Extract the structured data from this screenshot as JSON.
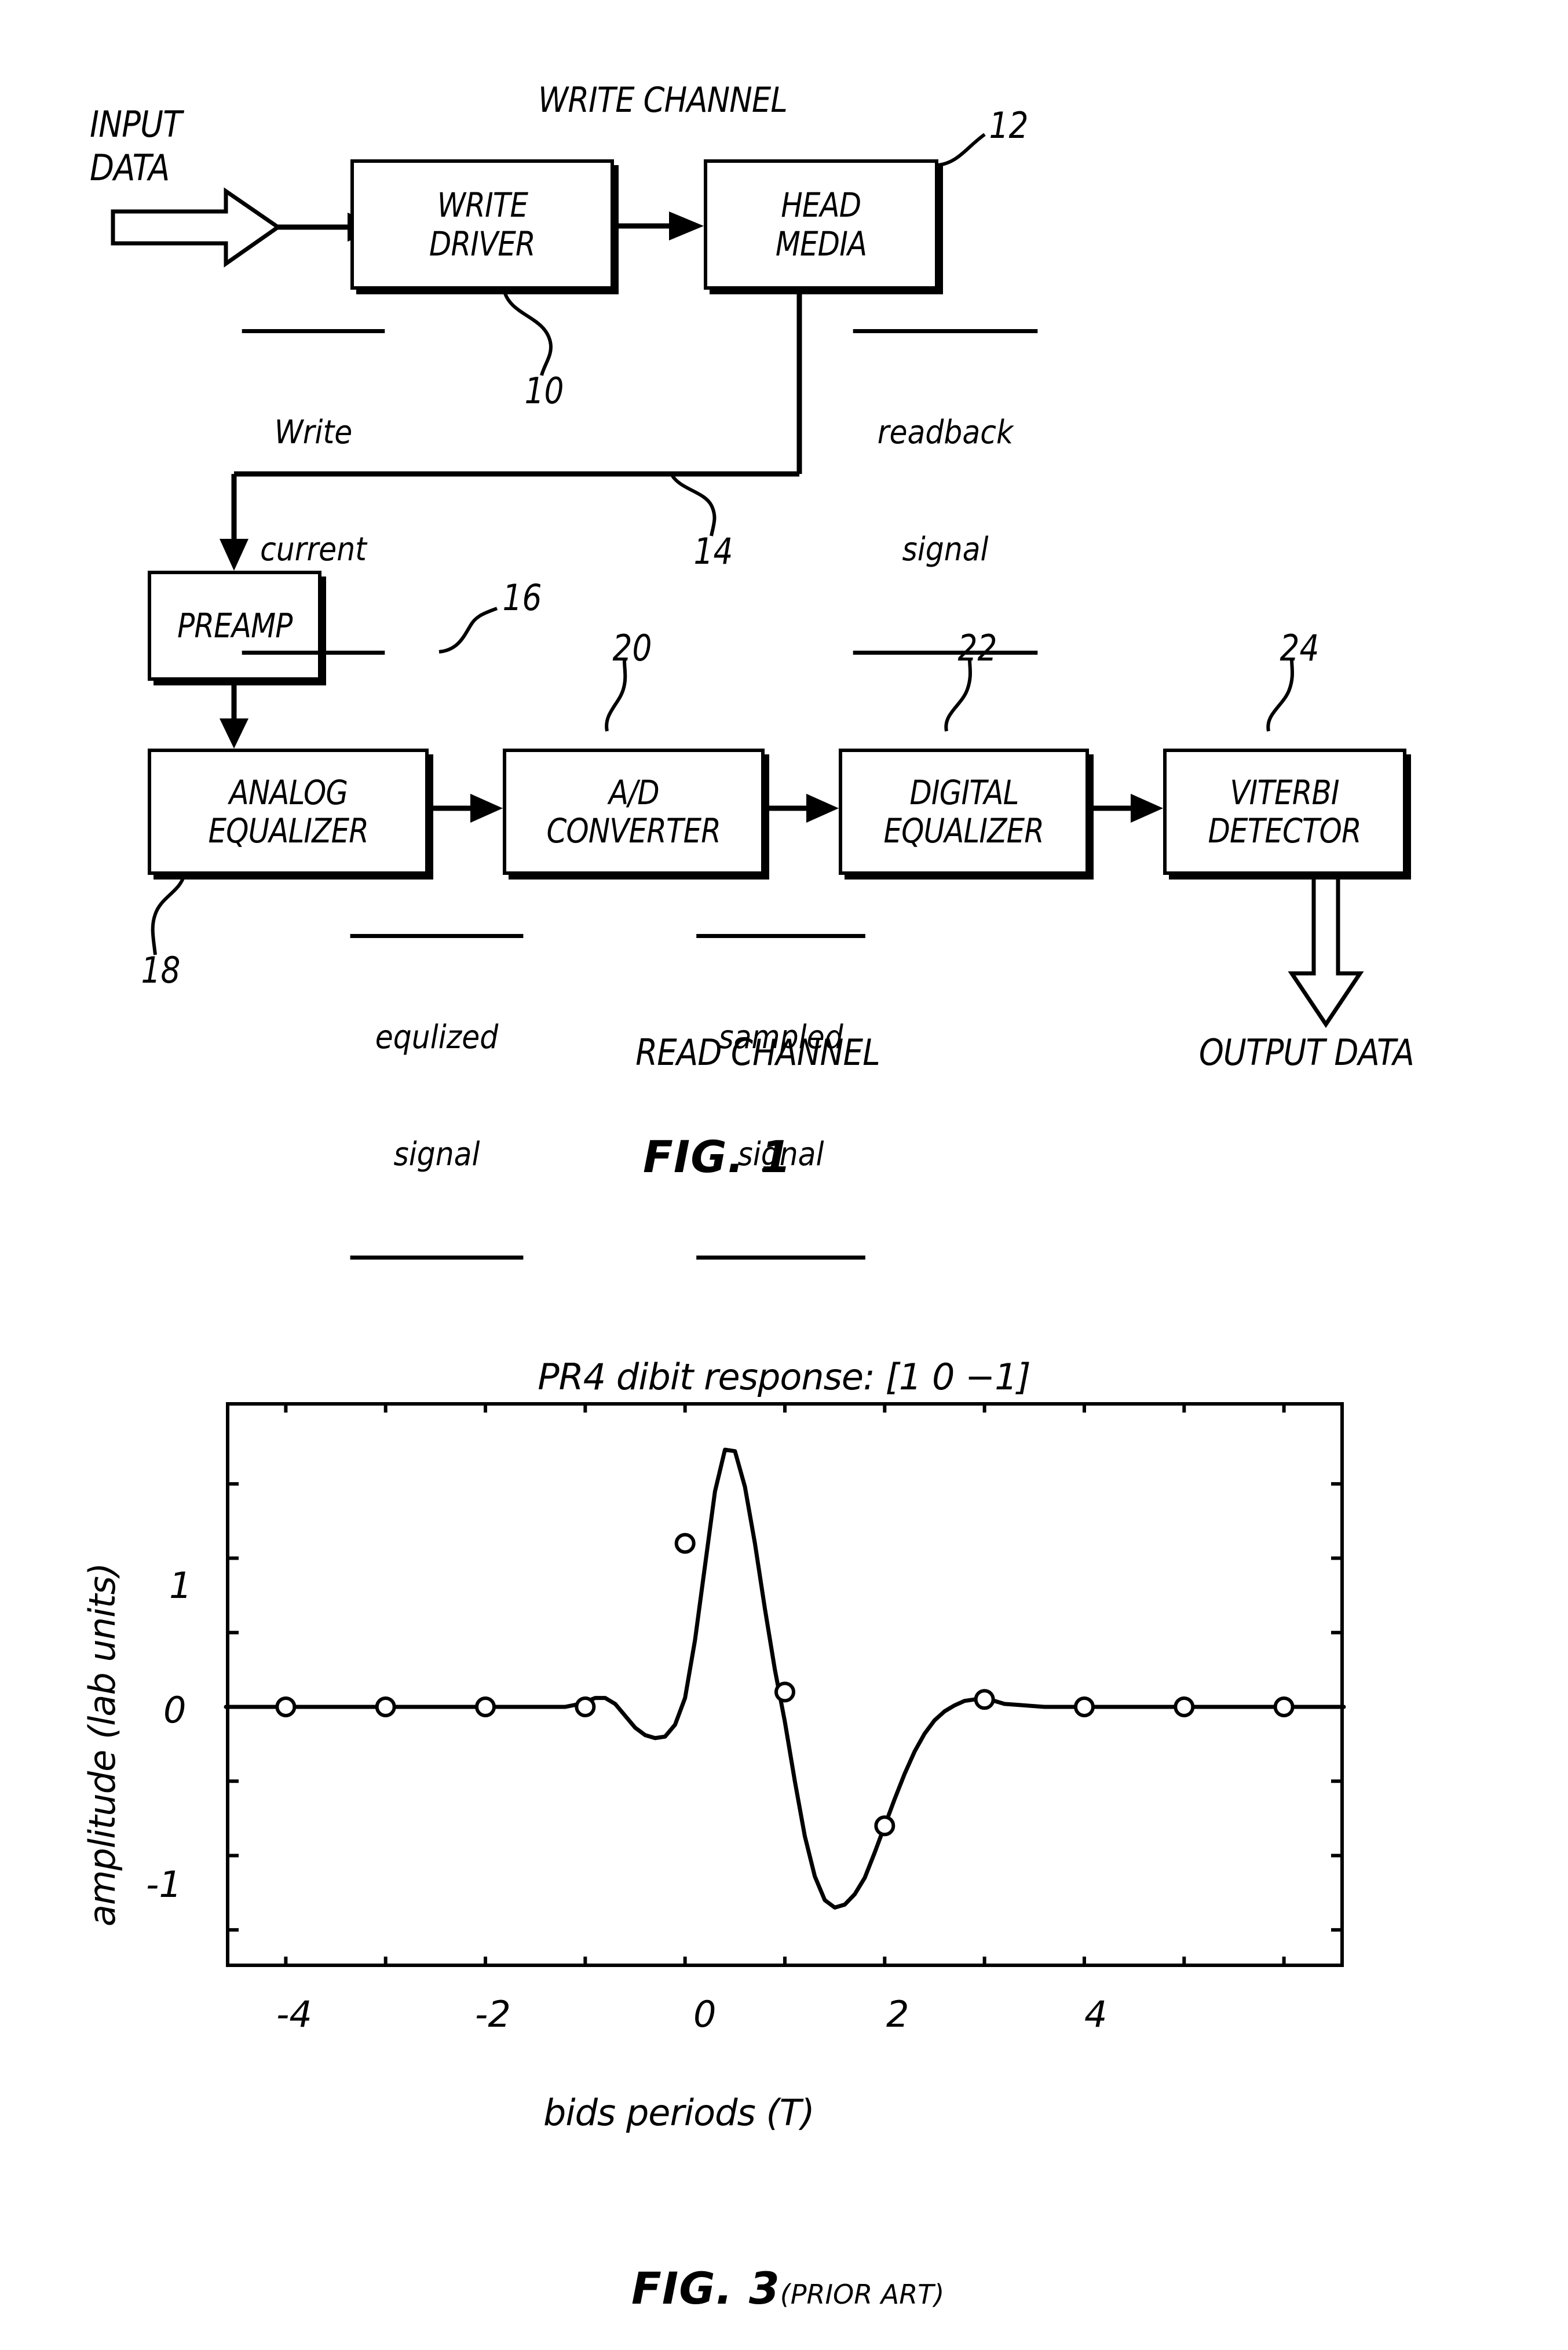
{
  "figure1": {
    "caption": "FIG. 1",
    "write_channel_header": "WRITE CHANNEL",
    "read_channel_header": "READ CHANNEL",
    "input_label_line1": "INPUT",
    "input_label_line2": "DATA",
    "output_label": "OUTPUT DATA",
    "blocks": [
      {
        "id": "write-driver",
        "line1": "WRITE",
        "line2": "DRIVER",
        "ref": "10"
      },
      {
        "id": "head-media",
        "line1": "HEAD",
        "line2": "MEDIA",
        "ref": "12"
      },
      {
        "id": "preamp",
        "line1": "PREAMP",
        "line2": "",
        "ref": "16"
      },
      {
        "id": "analog-equalizer",
        "line1": "ANALOG",
        "line2": "EQUALIZER",
        "ref": "18"
      },
      {
        "id": "ad-converter",
        "line1": "A/D",
        "line2": "CONVERTER",
        "ref": "20"
      },
      {
        "id": "digital-equalizer",
        "line1": "DIGITAL",
        "line2": "EQUALIZER",
        "ref": "22"
      },
      {
        "id": "viterbi-detector",
        "line1": "VITERBI",
        "line2": "DETECTOR",
        "ref": "24"
      }
    ],
    "signal_labels": [
      {
        "id": "write-current",
        "line1": "Write",
        "line2": "current"
      },
      {
        "id": "readback-signal",
        "line1": "readback",
        "line2": "signal"
      },
      {
        "id": "equlized-signal",
        "line1": "equlized",
        "line2": "signal"
      },
      {
        "id": "sampled-signal",
        "line1": "sampled",
        "line2": "signal"
      }
    ],
    "ref_numbers": [
      "10",
      "12",
      "14",
      "16",
      "18",
      "20",
      "22",
      "24"
    ]
  },
  "figure3": {
    "caption": "FIG. 3",
    "caption_suffix": "(PRIOR ART)"
  },
  "chart_data": {
    "type": "line",
    "title": "PR4 dibit response: [1 0 −1]",
    "xlabel": "bids periods (T)",
    "ylabel": "amplitude (lab units)",
    "xlim": [
      -5.6,
      5.6
    ],
    "ylim": [
      -1.75,
      2.05
    ],
    "xticks": [
      -4,
      -2,
      0,
      2,
      4
    ],
    "xticklabels": [
      "-4",
      "-2",
      "0",
      "2",
      "4"
    ],
    "xminorticks": [
      -5,
      -4,
      -3,
      -2,
      -1,
      0,
      1,
      2,
      3,
      4,
      5
    ],
    "yticks": [
      -1,
      0,
      1
    ],
    "yticklabels": [
      "-1",
      "0",
      "1"
    ],
    "yminorticks": [
      -1.5,
      -1,
      -0.5,
      0,
      0.5,
      1,
      1.5
    ],
    "grid": false,
    "legend": false,
    "series": [
      {
        "name": "PR4 dibit response (continuous)",
        "style": "solid-line",
        "x": [
          -5.6,
          -5.2,
          -4.8,
          -4.4,
          -4.0,
          -3.6,
          -3.2,
          -2.8,
          -2.4,
          -2.2,
          -2.05,
          -1.9,
          -1.8,
          -1.7,
          -1.6,
          -1.5,
          -1.4,
          -1.3,
          -1.2,
          -1.1,
          -1.0,
          -0.9,
          -0.8,
          -0.7,
          -0.6,
          -0.5,
          -0.4,
          -0.3,
          -0.2,
          -0.1,
          0.0,
          0.1,
          0.2,
          0.3,
          0.4,
          0.5,
          0.6,
          0.7,
          0.8,
          0.9,
          1.0,
          1.1,
          1.2,
          1.3,
          1.4,
          1.5,
          1.6,
          1.7,
          1.8,
          1.9,
          2.0,
          2.1,
          2.2,
          2.4,
          2.6,
          2.8,
          3.2,
          3.6,
          4.0,
          4.4,
          4.8,
          5.2,
          5.6
        ],
        "y": [
          0.0,
          0.0,
          0.0,
          0.0,
          0.0,
          0.0,
          0.0,
          0.0,
          0.0,
          0.0,
          0.02,
          0.06,
          0.06,
          0.02,
          -0.06,
          -0.14,
          -0.19,
          -0.21,
          -0.2,
          -0.12,
          0.06,
          0.45,
          0.95,
          1.45,
          1.73,
          1.72,
          1.48,
          1.1,
          0.66,
          0.25,
          -0.1,
          -0.5,
          -0.87,
          -1.14,
          -1.3,
          -1.35,
          -1.33,
          -1.26,
          -1.15,
          -0.98,
          -0.8,
          -0.62,
          -0.45,
          -0.3,
          -0.18,
          -0.09,
          -0.03,
          0.01,
          0.04,
          0.05,
          0.05,
          0.04,
          0.02,
          0.01,
          0.0,
          0.0,
          0.0,
          0.0,
          0.0,
          0.0,
          0.0,
          0.0,
          0.0
        ]
      },
      {
        "name": "sampled values (markers)",
        "style": "open-circle-markers",
        "x": [
          -5.0,
          -4.0,
          -3.0,
          -2.0,
          -1.0,
          0.0,
          1.0,
          2.0,
          3.0,
          4.0,
          5.0
        ],
        "y": [
          0.0,
          0.0,
          0.0,
          0.0,
          1.1,
          0.1,
          -0.8,
          0.05,
          0.0,
          0.0,
          0.0
        ]
      }
    ]
  }
}
